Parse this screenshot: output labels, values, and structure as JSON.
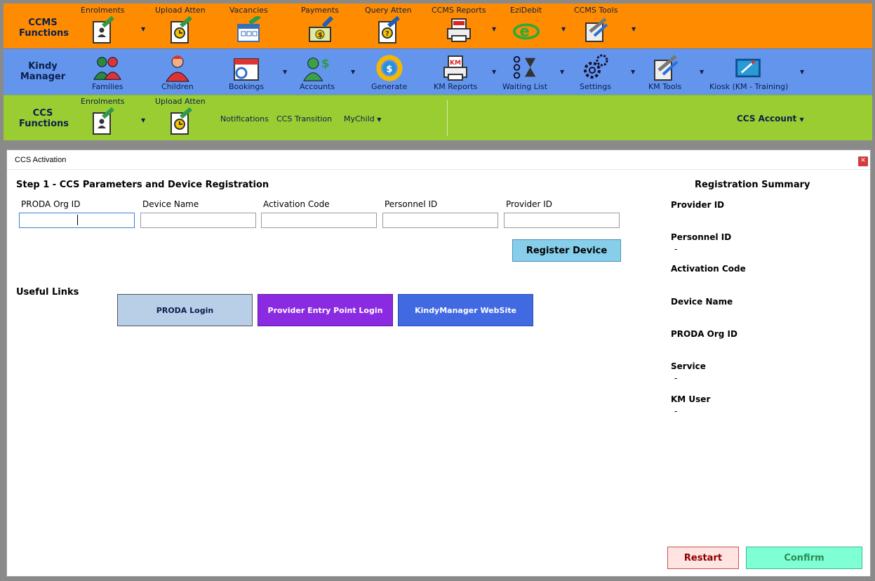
{
  "ribbon": {
    "ccms": {
      "group_label": "CCMS Functions",
      "items": [
        {
          "label": "Enrolments",
          "icon": "enrolment-form-icon"
        },
        {
          "label": "Upload Atten",
          "icon": "upload-attendance-icon"
        },
        {
          "label": "Vacancies",
          "icon": "calendar-vacancy-icon"
        },
        {
          "label": "Payments",
          "icon": "payment-money-icon"
        },
        {
          "label": "Query Atten",
          "icon": "query-attendance-icon"
        },
        {
          "label": "CCMS Reports",
          "icon": "printer-report-icon"
        },
        {
          "label": "EziDebit",
          "icon": "ezidebit-logo-icon"
        },
        {
          "label": "CCMS Tools",
          "icon": "tools-icon"
        }
      ]
    },
    "kindy": {
      "group_label": "Kindy Manager",
      "items": [
        {
          "label": "Families",
          "icon": "family-people-icon"
        },
        {
          "label": "Children",
          "icon": "child-person-icon"
        },
        {
          "label": "Bookings",
          "icon": "calendar-booking-icon"
        },
        {
          "label": "Accounts",
          "icon": "account-dollar-icon"
        },
        {
          "label": "Generate",
          "icon": "generate-refresh-dollar-icon"
        },
        {
          "label": "KM Reports",
          "icon": "printer-report-icon"
        },
        {
          "label": "Waiting List",
          "icon": "waiting-list-hourglass-icon"
        },
        {
          "label": "Settings",
          "icon": "gear-icon"
        },
        {
          "label": "KM Tools",
          "icon": "tools-icon"
        },
        {
          "label": "Kiosk (KM - Training)",
          "icon": "kiosk-tablet-icon"
        }
      ]
    },
    "ccs": {
      "group_label": "CCS Functions",
      "items": [
        {
          "label": "Enrolments",
          "icon": "enrolment-form-icon"
        },
        {
          "label": "Upload Atten",
          "icon": "upload-attendance-icon"
        }
      ],
      "links": [
        "Notifications",
        "CCS Transition",
        "MyChild"
      ],
      "account_menu": "CCS Account"
    }
  },
  "dialog": {
    "title": "CCS Activation",
    "step_heading": "Step 1 - CCS Parameters and Device Registration",
    "fields": [
      {
        "label": "PRODA Org ID",
        "value": ""
      },
      {
        "label": "Device Name",
        "value": ""
      },
      {
        "label": "Activation Code",
        "value": ""
      },
      {
        "label": "Personnel ID",
        "value": ""
      },
      {
        "label": "Provider ID",
        "value": ""
      }
    ],
    "register_button": "Register Device",
    "useful_links_heading": "Useful Links",
    "links": [
      {
        "label": "PRODA Login"
      },
      {
        "label": "Provider Entry Point Login"
      },
      {
        "label": "KindyManager WebSite"
      }
    ],
    "summary": {
      "heading": "Registration Summary",
      "items": [
        {
          "label": "Provider ID",
          "value": ""
        },
        {
          "label": "Personnel ID",
          "value": "-"
        },
        {
          "label": "Activation Code",
          "value": ""
        },
        {
          "label": "Device Name",
          "value": ""
        },
        {
          "label": "PRODA Org ID",
          "value": ""
        },
        {
          "label": "Service",
          "value": "-"
        },
        {
          "label": "KM User",
          "value": "-"
        }
      ]
    },
    "restart_button": "Restart",
    "confirm_button": "Confirm"
  },
  "colors": {
    "ccms_band": "#ff8c00",
    "kindy_band": "#6495ed",
    "ccs_band": "#9acd32",
    "provider_entry_button": "#8a2be2",
    "kindymanager_button": "#4169e1",
    "confirm_button": "#7fffd4",
    "restart_button": "#ffe4e1"
  }
}
